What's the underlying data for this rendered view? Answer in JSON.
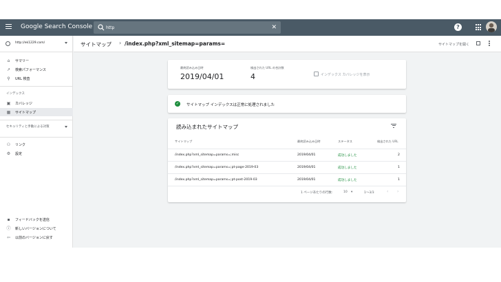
{
  "colors": {
    "topbar": "#4a5a66",
    "accent_green": "#1e8e3e",
    "background": "#f1f3f4"
  },
  "header": {
    "brand": "Google Search Console",
    "search_value": "http",
    "clear_icon": "close-icon"
  },
  "sidebar": {
    "property": "http://ek1229.com/",
    "items": [
      {
        "label": "サマリー",
        "icon": "home-icon"
      },
      {
        "label": "検索パフォーマンス",
        "icon": "trend-icon"
      },
      {
        "label": "URL 検査",
        "icon": "search-icon"
      }
    ],
    "index_section": "インデックス",
    "index_items": [
      {
        "label": "カバレッジ",
        "icon": "coverage-icon"
      },
      {
        "label": "サイトマップ",
        "icon": "sitemap-icon"
      }
    ],
    "enhancement_section": "セキュリティと手動による対策",
    "other_items": [
      {
        "label": "リンク",
        "icon": "links-icon"
      },
      {
        "label": "設定",
        "icon": "gear-icon"
      }
    ],
    "footer_items": [
      {
        "label": "フィードバックを送信",
        "icon": "feedback-icon"
      },
      {
        "label": "新しいバージョンについて",
        "icon": "info-icon"
      },
      {
        "label": "以前のバージョンに戻す",
        "icon": "exit-icon"
      }
    ]
  },
  "page": {
    "breadcrumb_root": "サイトマップ",
    "breadcrumb_current": "/index.php?xml_sitemap=params=",
    "open_sitemap": "サイトマップを開く"
  },
  "summary": {
    "last_read_label": "最終読み込み日時",
    "last_read_value": "2019/04/01",
    "urls_found_label": "検出された URL の合計数",
    "urls_found_value": "4",
    "coverage_link": "インデックス カバレッジを表示"
  },
  "status_banner": "サイトマップ インデックスは正常に処理されました",
  "table": {
    "title": "読み込まれたサイトマップ",
    "columns": [
      "サイトマップ",
      "最終読み込み日時",
      "ステータス",
      "検出された URL"
    ],
    "rows": [
      {
        "sitemap": "/index.php?xml_sitemap=params=;misc",
        "date": "2019/04/01",
        "status": "成功しました",
        "urls": "2"
      },
      {
        "sitemap": "/index.php?xml_sitemap=params=;pt-page-2019-03",
        "date": "2019/04/01",
        "status": "成功しました",
        "urls": "1"
      },
      {
        "sitemap": "/index.php?xml_sitemap=params=;pt-post-2019-03",
        "date": "2019/04/01",
        "status": "成功しました",
        "urls": "1"
      }
    ],
    "rows_per_page_label": "1 ページあたりの行数:",
    "rows_per_page_value": "10",
    "range": "1～3/3"
  }
}
